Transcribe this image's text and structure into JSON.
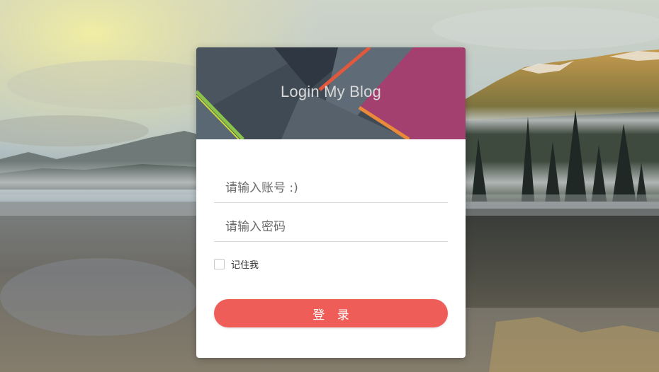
{
  "login": {
    "title": "Login My Blog",
    "username_placeholder": "请输入账号 :)",
    "username_value": "",
    "password_placeholder": "请输入密码",
    "password_value": "",
    "remember_label": "记住我",
    "submit_label": "登 录"
  },
  "colors": {
    "button": "#ef5d59",
    "header_dark": "#3f4a55",
    "header_magenta": "#a3406f"
  }
}
